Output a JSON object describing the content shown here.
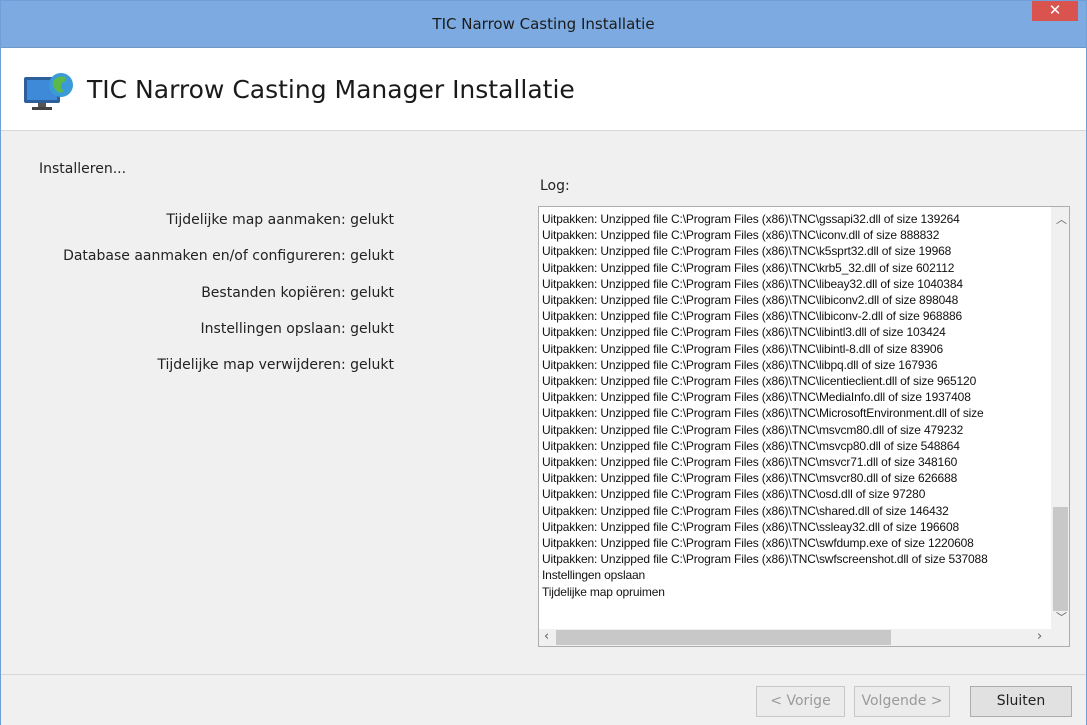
{
  "window": {
    "title": "TIC Narrow Casting Installatie",
    "close_glyph": "✕"
  },
  "header": {
    "title": "TIC Narrow Casting Manager Installatie",
    "icon": "monitor-globe-icon"
  },
  "status": "Installeren...",
  "steps": [
    {
      "label": "Tijdelijke map aanmaken:",
      "result": "gelukt"
    },
    {
      "label": "Database aanmaken en/of configureren:",
      "result": "gelukt"
    },
    {
      "label": "Bestanden kopiëren:",
      "result": "gelukt"
    },
    {
      "label": "Instellingen opslaan:",
      "result": "gelukt"
    },
    {
      "label": "Tijdelijke map verwijderen:",
      "result": "gelukt"
    }
  ],
  "log": {
    "label": "Log:",
    "lines": [
      "Uitpakken: Unzipped file C:\\Program Files (x86)\\TNC\\gssapi32.dll of size 139264",
      "Uitpakken: Unzipped file C:\\Program Files (x86)\\TNC\\iconv.dll of size 888832",
      "Uitpakken: Unzipped file C:\\Program Files (x86)\\TNC\\k5sprt32.dll of size 19968",
      "Uitpakken: Unzipped file C:\\Program Files (x86)\\TNC\\krb5_32.dll of size 602112",
      "Uitpakken: Unzipped file C:\\Program Files (x86)\\TNC\\libeay32.dll of size 1040384",
      "Uitpakken: Unzipped file C:\\Program Files (x86)\\TNC\\libiconv2.dll of size 898048",
      "Uitpakken: Unzipped file C:\\Program Files (x86)\\TNC\\libiconv-2.dll of size 968886",
      "Uitpakken: Unzipped file C:\\Program Files (x86)\\TNC\\libintl3.dll of size 103424",
      "Uitpakken: Unzipped file C:\\Program Files (x86)\\TNC\\libintl-8.dll of size 83906",
      "Uitpakken: Unzipped file C:\\Program Files (x86)\\TNC\\libpq.dll of size 167936",
      "Uitpakken: Unzipped file C:\\Program Files (x86)\\TNC\\licentieclient.dll of size 965120",
      "Uitpakken: Unzipped file C:\\Program Files (x86)\\TNC\\MediaInfo.dll of size 1937408",
      "Uitpakken: Unzipped file C:\\Program Files (x86)\\TNC\\MicrosoftEnvironment.dll of size",
      "Uitpakken: Unzipped file C:\\Program Files (x86)\\TNC\\msvcm80.dll of size 479232",
      "Uitpakken: Unzipped file C:\\Program Files (x86)\\TNC\\msvcp80.dll of size 548864",
      "Uitpakken: Unzipped file C:\\Program Files (x86)\\TNC\\msvcr71.dll of size 348160",
      "Uitpakken: Unzipped file C:\\Program Files (x86)\\TNC\\msvcr80.dll of size 626688",
      "Uitpakken: Unzipped file C:\\Program Files (x86)\\TNC\\osd.dll of size 97280",
      "Uitpakken: Unzipped file C:\\Program Files (x86)\\TNC\\shared.dll of size 146432",
      "Uitpakken: Unzipped file C:\\Program Files (x86)\\TNC\\ssleay32.dll of size 196608",
      "Uitpakken: Unzipped file C:\\Program Files (x86)\\TNC\\swfdump.exe of size 1220608",
      "Uitpakken: Unzipped file C:\\Program Files (x86)\\TNC\\swfscreenshot.dll of size 537088",
      "Instellingen opslaan",
      "Tijdelijke map opruimen"
    ]
  },
  "footer": {
    "prev_label": "< Vorige",
    "next_label": "Volgende >",
    "close_label": "Sluiten"
  },
  "colors": {
    "titlebar": "#7dabe1",
    "close": "#d9534f"
  }
}
